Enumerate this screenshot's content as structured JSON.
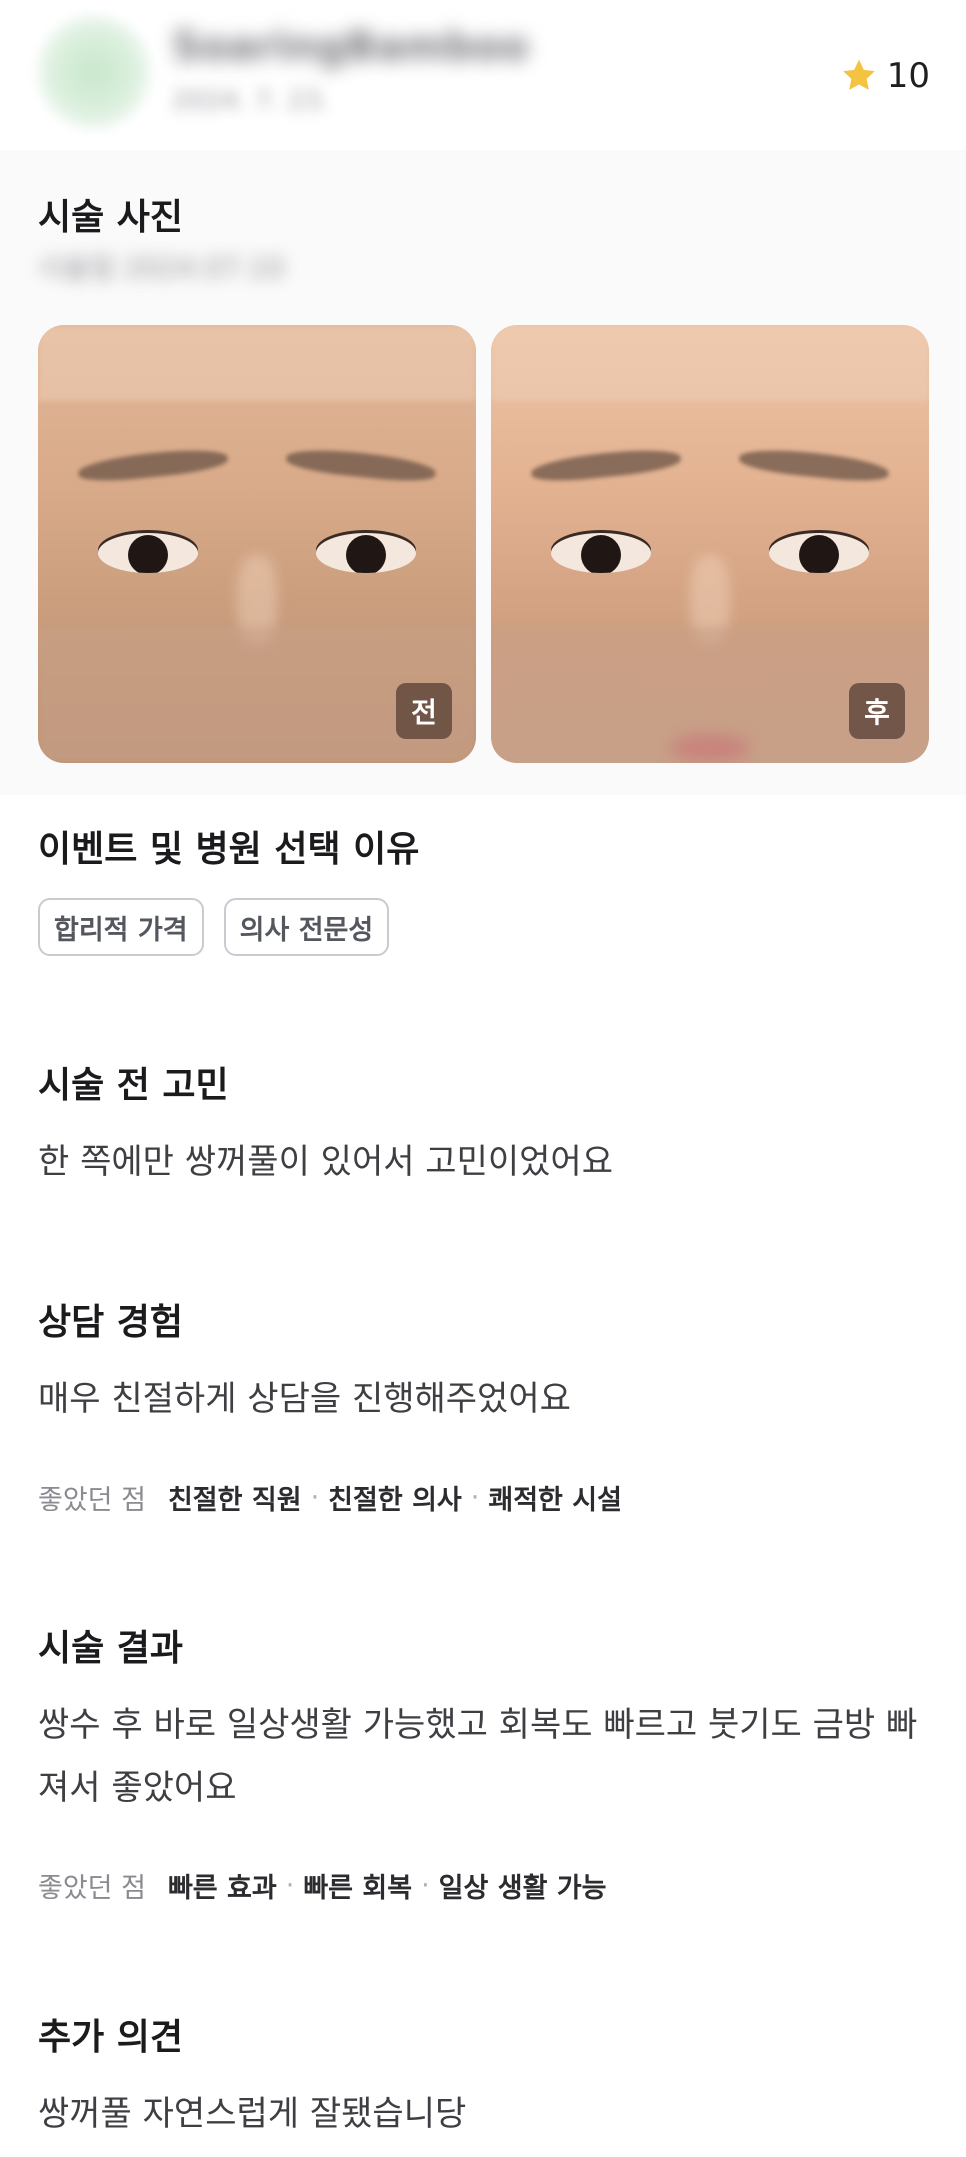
{
  "header": {
    "username": "SoaringBamboo",
    "user_meta": "2024. 7. 23.",
    "rating": "10"
  },
  "photos": {
    "title": "시술 사진",
    "date": "시술일 2024.07.10",
    "before_label": "전",
    "after_label": "후"
  },
  "reasons": {
    "title": "이벤트 및 병원 선택 이유",
    "tags": [
      "합리적 가격",
      "의사 전문성"
    ]
  },
  "concern": {
    "title": "시술 전 고민",
    "text": "한 쪽에만 쌍꺼풀이 있어서 고민이었어요"
  },
  "consultation": {
    "title": "상담 경험",
    "text": "매우 친절하게 상담을 진행해주었어요",
    "good_label": "좋았던 점",
    "good_points": [
      "친절한 직원",
      "친절한 의사",
      "쾌적한 시설"
    ]
  },
  "result": {
    "title": "시술 결과",
    "text": "쌍수 후 바로 일상생활 가능했고 회복도 빠르고 붓기도 금방 빠져서 좋았어요",
    "good_label": "좋았던 점",
    "good_points": [
      "빠른 효과",
      "빠른 회복",
      "일상 생활 가능"
    ]
  },
  "extra": {
    "title": "추가 의견",
    "text": "쌍꺼풀 자연스럽게 잘됐습니당"
  },
  "colors": {
    "star": "#F5C342",
    "tag_border": "#C9CBD1",
    "badge_bg": "#5A4137"
  }
}
